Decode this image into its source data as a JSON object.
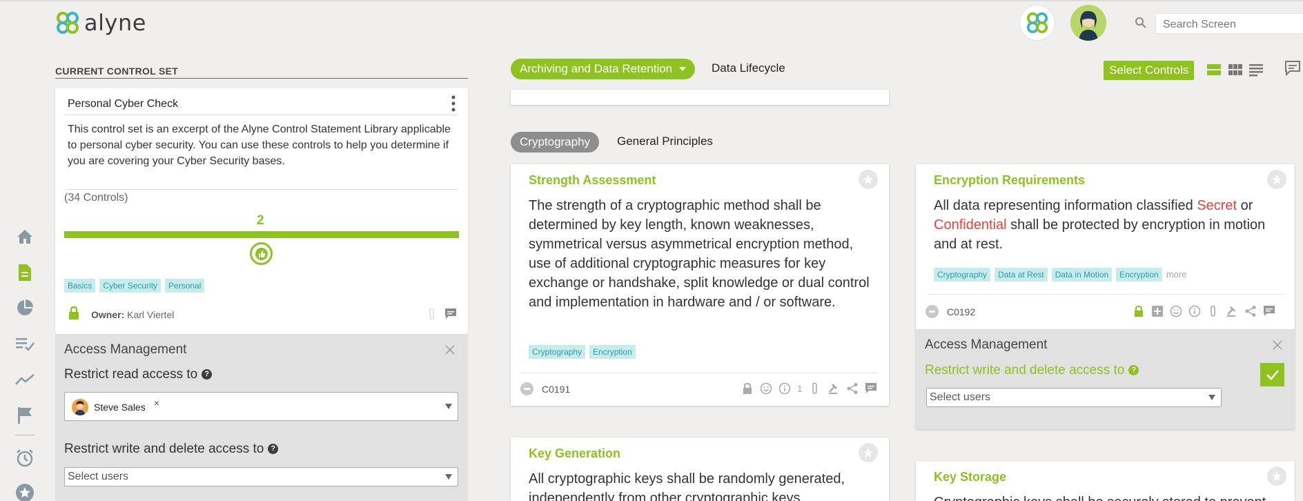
{
  "brand": {
    "name": "alyne",
    "accent": "#8dc21f"
  },
  "header": {
    "search_placeholder": "Search Screen"
  },
  "left_panel": {
    "section_title": "CURRENT CONTROL SET",
    "control_set": {
      "name": "Personal Cyber Check",
      "description": "This control set is an excerpt of the Alyne Control Statement Library applicable to personal cyber security. You can use these controls to help you determine if you are covering your Cyber Security bases.",
      "count_label": "(34 Controls)",
      "progress_value": "2",
      "progress_fraction": 1.0,
      "tags": [
        "Basics",
        "Cyber Security",
        "Personal"
      ],
      "owner_label": "Owner:",
      "owner_name": "Karl Viertel"
    },
    "access": {
      "title": "Access Management",
      "read_label": "Restrict read access to",
      "read_user": "Steve Sales",
      "write_label": "Restrict write and delete access to",
      "write_placeholder": "Select users"
    }
  },
  "toolbar": {
    "active_domain": "Archiving and Data Retention",
    "other_domain": "Data Lifecycle",
    "select_controls": "Select Controls"
  },
  "subtabs": {
    "active": "Cryptography",
    "other": "General Principles"
  },
  "controls": [
    {
      "title": "Strength Assessment",
      "body": "The strength of a cryptographic method shall be determined by key length, known weaknesses, symmetrical versus asymmetrical encryption method, use of additional cryptographic measures for key exchange or handshake, split knowledge or dual control and implementation in hardware and / or software.",
      "tags": [
        "Cryptography",
        "Encryption"
      ],
      "id": "C0191",
      "attachment_count": "1"
    },
    {
      "title": "Encryption Requirements",
      "body_parts": [
        "All data representing information classified ",
        "Secret",
        " or ",
        "Confidential",
        " shall be protected by encryption in motion and at rest."
      ],
      "tags": [
        "Cryptography",
        "Data at Rest",
        "Data in Motion",
        "Encryption"
      ],
      "more": "more",
      "id": "C0192",
      "access": {
        "title": "Access Management",
        "write_label": "Restrict write and delete access to",
        "write_placeholder": "Select users"
      }
    },
    {
      "title": "Key Generation",
      "body": "All cryptographic keys shall be randomly generated, independently from other cryptographic keys."
    },
    {
      "title": "Key Storage",
      "body": "Cryptographic keys shall be securely stored to prevent"
    }
  ]
}
